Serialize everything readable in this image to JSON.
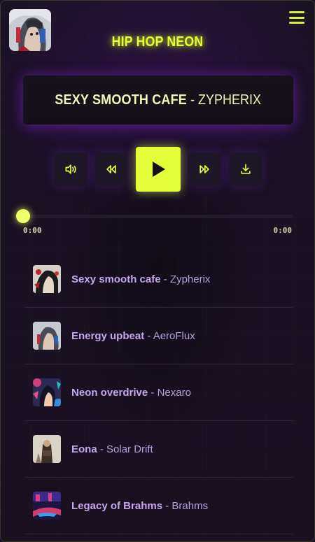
{
  "header": {
    "title": "HIP HOP NEON",
    "avatar_icon": "cyberpunk-girl-avatar",
    "menu_icon": "hamburger-menu-icon"
  },
  "now_playing": {
    "title": "SEXY SMOOTH CAFE",
    "separator": " - ",
    "artist": "ZYPHERIX"
  },
  "controls": {
    "volume_icon": "volume-icon",
    "rewind_icon": "rewind-icon",
    "play_icon": "play-icon",
    "forward_icon": "fast-forward-icon",
    "download_icon": "download-icon"
  },
  "progress": {
    "current_time": "0:00",
    "duration": "0:00",
    "fraction": 0
  },
  "playlist": [
    {
      "name": "Sexy smooth cafe",
      "separator": " - ",
      "artist": "Zypherix"
    },
    {
      "name": "Energy upbeat",
      "separator": " - ",
      "artist": "AeroFlux"
    },
    {
      "name": "Neon overdrive",
      "separator": " - ",
      "artist": "Nexaro"
    },
    {
      "name": "Eona",
      "separator": " - ",
      "artist": "Solar Drift"
    },
    {
      "name": "Legacy of Brahms",
      "separator": " - ",
      "artist": "Brahms"
    }
  ],
  "colors": {
    "accent": "#e4ff3a",
    "background": "#1a1124",
    "track_name": "#c3a6ec"
  }
}
